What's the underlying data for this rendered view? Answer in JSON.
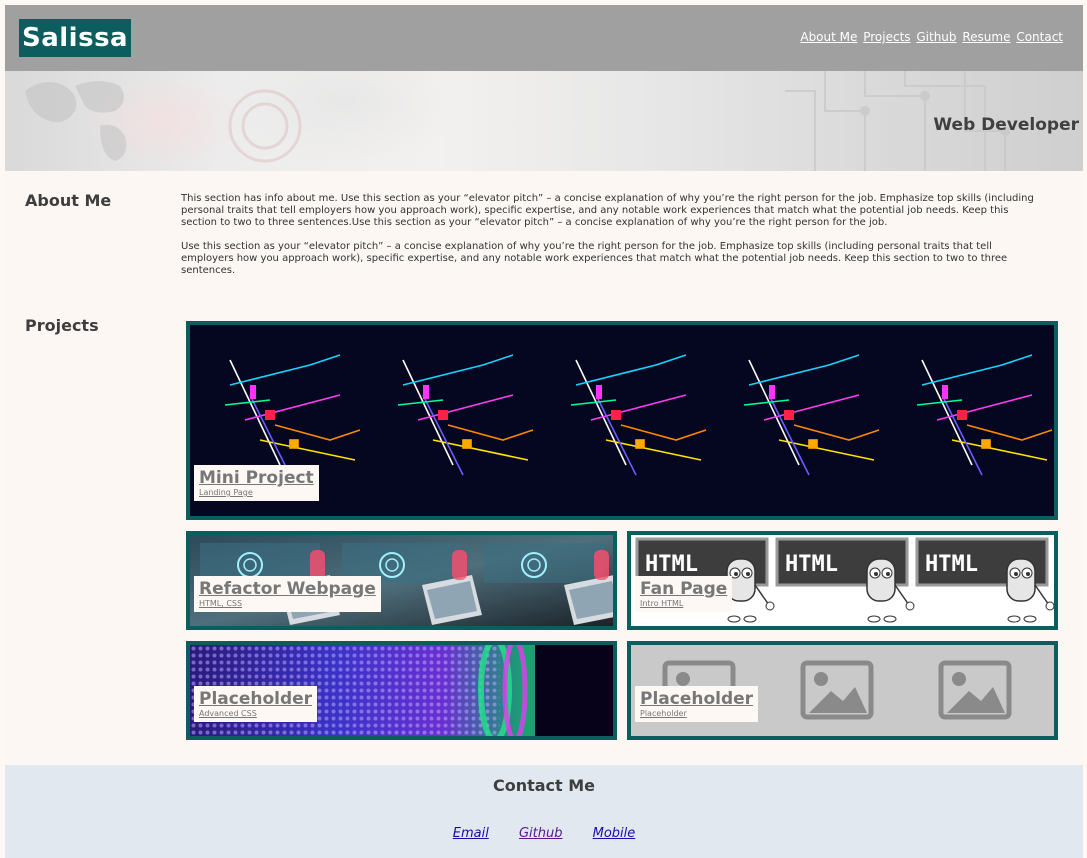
{
  "header": {
    "logo": "Salissa",
    "nav": [
      "About Me",
      "Projects",
      "Github",
      "Resume",
      "Contact"
    ]
  },
  "hero": {
    "title": "Web Developer"
  },
  "about": {
    "heading": "About Me",
    "paragraphs": [
      "This section has info about me. Use this section as your “elevator pitch” – a concise explanation of why you’re the right person for the job. Emphasize top skills (including personal traits that tell employers how you approach work), specific expertise, and any notable work experiences that match what the potential job needs. Keep this section to two to three sentences.Use this section as your “elevator pitch” – a concise explanation of why you’re the right person for the job.",
      "Use this section as your “elevator pitch” – a concise explanation of why you’re the right person for the job. Emphasize top skills (including personal traits that tell employers how you approach work), specific expertise, and any notable work experiences that match what the potential job needs. Keep this section to two to three sentences."
    ]
  },
  "projects": {
    "heading": "Projects",
    "items": [
      {
        "title": "Mini Project",
        "subtitle": "Landing Page"
      },
      {
        "title": "Refactor Webpage",
        "subtitle": "HTML, CSS"
      },
      {
        "title": "Fan Page",
        "subtitle": "Intro HTML"
      },
      {
        "title": "Placeholder",
        "subtitle": "Advanced CSS"
      },
      {
        "title": "Placeholder",
        "subtitle": "Placeholder"
      }
    ],
    "html_board_text": "HTML"
  },
  "contact": {
    "heading": "Contact Me",
    "links": [
      "Email",
      "Github",
      "Mobile"
    ]
  },
  "colors": {
    "accent": "#0b5d5e",
    "header_bg": "#a0a0a0",
    "page_bg": "#fcf7f3",
    "contact_bg": "#e1e8ef"
  }
}
